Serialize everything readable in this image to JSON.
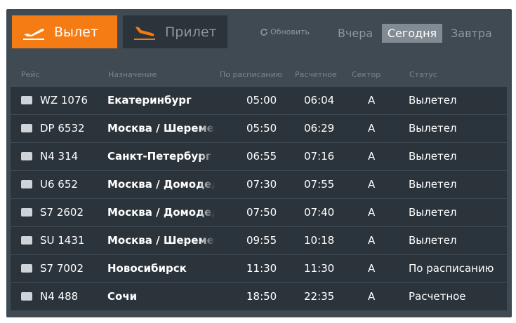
{
  "tabs": {
    "departure": "Вылет",
    "arrival": "Прилет"
  },
  "refresh_label": "Обновить",
  "days": {
    "yesterday": "Вчера",
    "today": "Сегодня",
    "tomorrow": "Завтра"
  },
  "columns": {
    "flight": "Рейс",
    "destination": "Назначение",
    "scheduled": "По расписанию",
    "estimated": "Расчетное",
    "sector": "Сектор",
    "status": "Статус"
  },
  "colors": {
    "accent": "#f57c14",
    "panel": "#3f4a53",
    "row": "#2b343b"
  },
  "flights": [
    {
      "flight": "WZ 1076",
      "destination": "Екатеринбург",
      "scheduled": "05:00",
      "estimated": "06:04",
      "sector": "A",
      "status": "Вылетел"
    },
    {
      "flight": "DP 6532",
      "destination": "Москва / Шереметьево",
      "scheduled": "05:50",
      "estimated": "06:29",
      "sector": "A",
      "status": "Вылетел"
    },
    {
      "flight": "N4 314",
      "destination": "Санкт-Петербург",
      "scheduled": "06:55",
      "estimated": "07:16",
      "sector": "A",
      "status": "Вылетел"
    },
    {
      "flight": "U6 652",
      "destination": "Москва / Домодедово",
      "scheduled": "07:30",
      "estimated": "07:55",
      "sector": "A",
      "status": "Вылетел"
    },
    {
      "flight": "S7 2602",
      "destination": "Москва / Домодедово",
      "scheduled": "07:50",
      "estimated": "07:40",
      "sector": "A",
      "status": "Вылетел"
    },
    {
      "flight": "SU 1431",
      "destination": "Москва / Шереметьево",
      "scheduled": "09:55",
      "estimated": "10:18",
      "sector": "A",
      "status": "Вылетел"
    },
    {
      "flight": "S7 7002",
      "destination": "Новосибирск",
      "scheduled": "11:30",
      "estimated": "11:30",
      "sector": "A",
      "status": "По расписанию"
    },
    {
      "flight": "N4 488",
      "destination": "Сочи",
      "scheduled": "18:50",
      "estimated": "22:35",
      "sector": "A",
      "status": "Расчетное"
    }
  ]
}
